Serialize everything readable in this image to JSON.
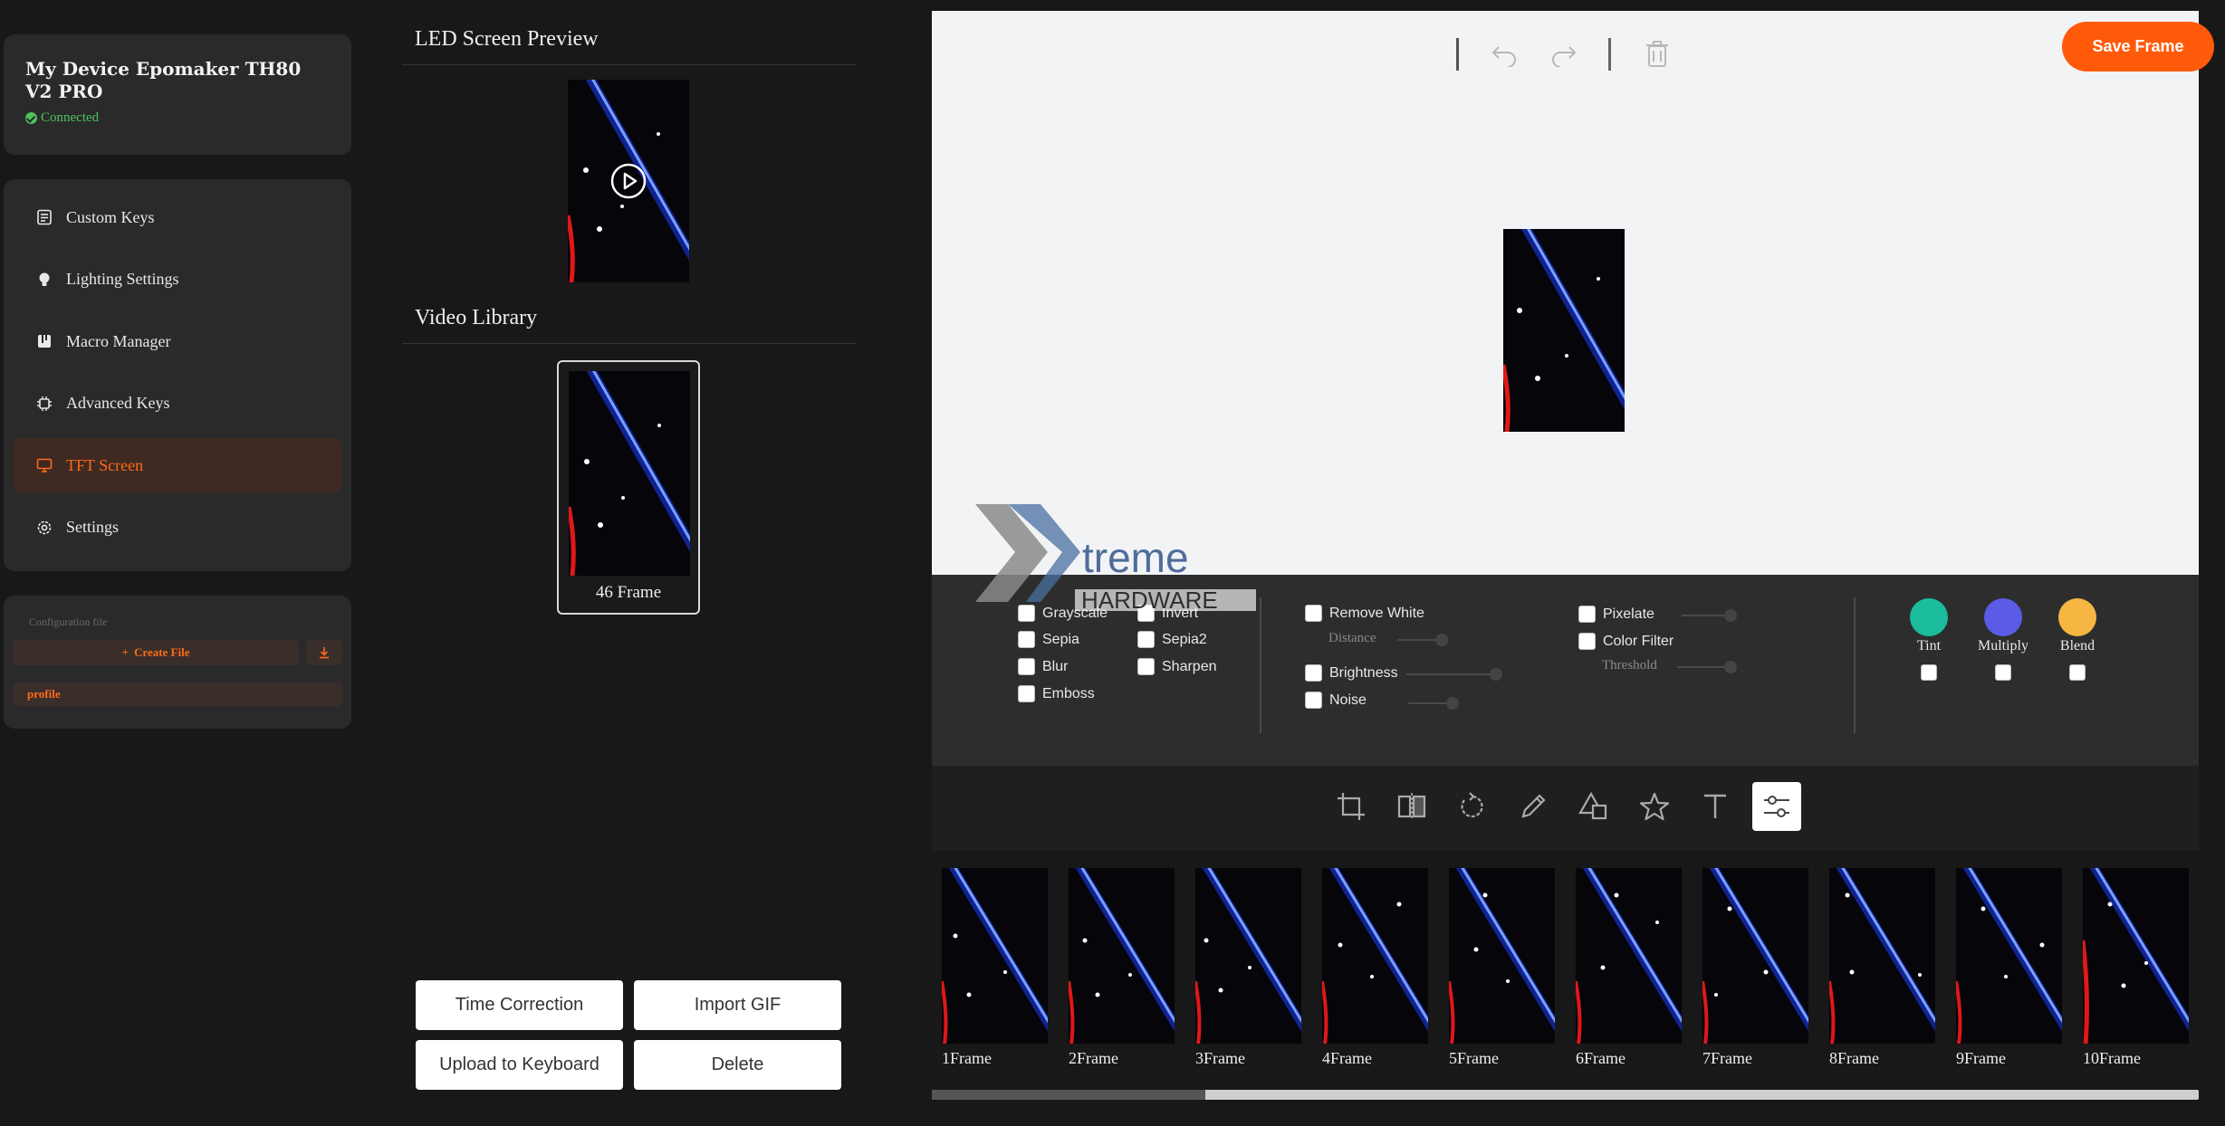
{
  "device": {
    "name": "My Device Epomaker TH80 V2 PRO",
    "status": "Connected"
  },
  "sidebar": {
    "items": [
      {
        "label": "Custom Keys",
        "icon": "keyboard-list-icon"
      },
      {
        "label": "Lighting Settings",
        "icon": "bulb-icon"
      },
      {
        "label": "Macro Manager",
        "icon": "macro-icon"
      },
      {
        "label": "Advanced Keys",
        "icon": "chip-icon"
      },
      {
        "label": "TFT Screen",
        "icon": "monitor-icon",
        "active": true
      },
      {
        "label": "Settings",
        "icon": "gear-icon"
      }
    ]
  },
  "config": {
    "title": "Configuration file",
    "create_label": "Create File",
    "profile": "profile"
  },
  "preview": {
    "title": "LED Screen Preview"
  },
  "library": {
    "title": "Video Library",
    "item_label": "46 Frame"
  },
  "actions": {
    "time_correction": "Time Correction",
    "import_gif": "Import GIF",
    "upload": "Upload to Keyboard",
    "delete": "Delete"
  },
  "editor": {
    "save_label": "Save Frame"
  },
  "filters": {
    "grayscale": "Grayscale",
    "invert": "Invert",
    "sepia": "Sepia",
    "sepia2": "Sepia2",
    "blur": "Blur",
    "sharpen": "Sharpen",
    "emboss": "Emboss",
    "remove_white": "Remove White",
    "distance": "Distance",
    "brightness": "Brightness",
    "noise": "Noise",
    "pixelate": "Pixelate",
    "color_filter": "Color Filter",
    "threshold": "Threshold",
    "tint": "Tint",
    "multiply": "Multiply",
    "blend": "Blend"
  },
  "blend_colors": {
    "tint": "#1abc9c",
    "multiply": "#5b5be6",
    "blend": "#f5b642"
  },
  "frames": [
    "1Frame",
    "2Frame",
    "3Frame",
    "4Frame",
    "5Frame",
    "6Frame",
    "7Frame",
    "8Frame",
    "9Frame",
    "10Frame"
  ],
  "watermark": {
    "line1": "treme",
    "line2": "HARDWARE"
  },
  "accent": "#ff5a0a"
}
